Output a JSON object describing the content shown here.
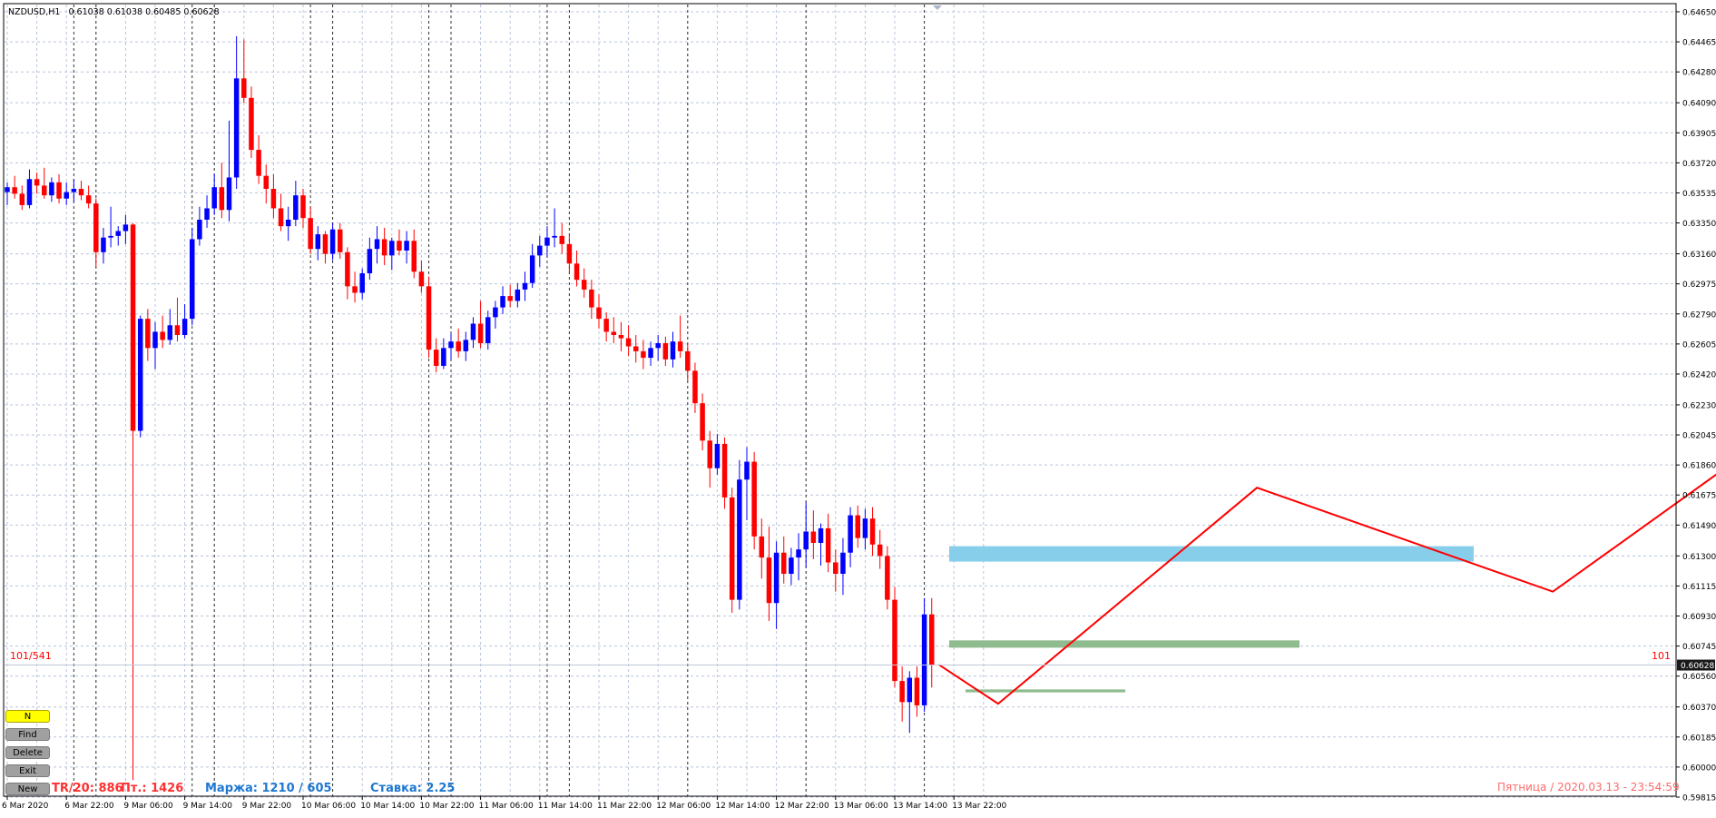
{
  "header": {
    "symbol": "NZDUSD,H1",
    "ohlc": "0.61038 0.61038 0.60485 0.60628"
  },
  "colors": {
    "bull": "#0000ff",
    "bear": "#ff0000",
    "grid": "#b8c4dc",
    "axis": "#000000",
    "zone_blue": "#87ceeb",
    "zone_green": "#8fbc8f",
    "path": "#ff0000"
  },
  "chart_data": {
    "type": "candlestick",
    "y_ticks": [
      "0.64650",
      "0.64465",
      "0.64280",
      "0.64090",
      "0.63905",
      "0.63720",
      "0.63535",
      "0.63350",
      "0.63160",
      "0.62975",
      "0.62790",
      "0.62605",
      "0.62420",
      "0.62230",
      "0.62045",
      "0.61860",
      "0.61675",
      "0.61490",
      "0.61300",
      "0.61115",
      "0.60930",
      "0.60745",
      "0.60560",
      "0.60370",
      "0.60185",
      "0.60000",
      "0.59815"
    ],
    "ylim": [
      0.59815,
      0.6465
    ],
    "current_price": "0.60628",
    "x_labels": [
      "6 Mar 2020",
      "6 Mar 22:00",
      "9 Mar 06:00",
      "9 Mar 14:00",
      "9 Mar 22:00",
      "10 Mar 06:00",
      "10 Mar 14:00",
      "10 Mar 22:00",
      "11 Mar 06:00",
      "11 Mar 14:00",
      "11 Mar 22:00",
      "12 Mar 06:00",
      "12 Mar 14:00",
      "12 Mar 22:00",
      "13 Mar 06:00",
      "13 Mar 14:00",
      "13 Mar 22:00"
    ],
    "candles": [
      [
        0.6354,
        0.636,
        0.6346,
        0.6357
      ],
      [
        0.6357,
        0.6364,
        0.635,
        0.6353
      ],
      [
        0.6353,
        0.6358,
        0.6343,
        0.6346
      ],
      [
        0.6346,
        0.6368,
        0.6344,
        0.6362
      ],
      [
        0.6362,
        0.6366,
        0.6353,
        0.6358
      ],
      [
        0.6358,
        0.6369,
        0.635,
        0.6352
      ],
      [
        0.6352,
        0.6363,
        0.6348,
        0.636
      ],
      [
        0.636,
        0.6365,
        0.6347,
        0.635
      ],
      [
        0.635,
        0.636,
        0.6346,
        0.6354
      ],
      [
        0.6354,
        0.6362,
        0.6348,
        0.6356
      ],
      [
        0.6356,
        0.6361,
        0.6349,
        0.6352
      ],
      [
        0.6352,
        0.6358,
        0.6344,
        0.6347
      ],
      [
        0.6347,
        0.635,
        0.6308,
        0.6317
      ],
      [
        0.6317,
        0.6332,
        0.631,
        0.6326
      ],
      [
        0.6326,
        0.6345,
        0.632,
        0.6327
      ],
      [
        0.6327,
        0.6333,
        0.6321,
        0.633
      ],
      [
        0.633,
        0.634,
        0.6322,
        0.6334
      ],
      [
        0.6334,
        0.6335,
        0.5992,
        0.6207
      ],
      [
        0.6207,
        0.6278,
        0.6203,
        0.6276
      ],
      [
        0.6276,
        0.6282,
        0.625,
        0.6258
      ],
      [
        0.6258,
        0.6274,
        0.6245,
        0.6268
      ],
      [
        0.6268,
        0.6278,
        0.6258,
        0.6263
      ],
      [
        0.6263,
        0.6282,
        0.626,
        0.6272
      ],
      [
        0.6272,
        0.6289,
        0.6262,
        0.6266
      ],
      [
        0.6266,
        0.6285,
        0.6264,
        0.6276
      ],
      [
        0.6276,
        0.6332,
        0.6272,
        0.6325
      ],
      [
        0.6325,
        0.6345,
        0.6321,
        0.6337
      ],
      [
        0.6337,
        0.6352,
        0.6332,
        0.6344
      ],
      [
        0.6344,
        0.6365,
        0.634,
        0.6357
      ],
      [
        0.6357,
        0.6372,
        0.6338,
        0.6343
      ],
      [
        0.6343,
        0.6398,
        0.6336,
        0.6363
      ],
      [
        0.6363,
        0.645,
        0.6356,
        0.6424
      ],
      [
        0.6424,
        0.6448,
        0.6409,
        0.6412
      ],
      [
        0.6412,
        0.6419,
        0.6375,
        0.638
      ],
      [
        0.638,
        0.6389,
        0.6359,
        0.6364
      ],
      [
        0.6364,
        0.6371,
        0.6347,
        0.6356
      ],
      [
        0.6356,
        0.6365,
        0.6338,
        0.6344
      ],
      [
        0.6344,
        0.6353,
        0.633,
        0.6333
      ],
      [
        0.6333,
        0.6345,
        0.6324,
        0.6337
      ],
      [
        0.6337,
        0.6361,
        0.6333,
        0.6352
      ],
      [
        0.6352,
        0.6356,
        0.6332,
        0.6338
      ],
      [
        0.6338,
        0.6345,
        0.6316,
        0.6319
      ],
      [
        0.6319,
        0.6333,
        0.6312,
        0.6328
      ],
      [
        0.6328,
        0.633,
        0.631,
        0.6316
      ],
      [
        0.6316,
        0.6335,
        0.6312,
        0.6331
      ],
      [
        0.6331,
        0.6335,
        0.6313,
        0.6317
      ],
      [
        0.6317,
        0.632,
        0.6288,
        0.6296
      ],
      [
        0.6296,
        0.6305,
        0.6286,
        0.6292
      ],
      [
        0.6292,
        0.6307,
        0.6288,
        0.6304
      ],
      [
        0.6304,
        0.6326,
        0.63,
        0.6319
      ],
      [
        0.6319,
        0.6333,
        0.631,
        0.6325
      ],
      [
        0.6325,
        0.6332,
        0.6309,
        0.6315
      ],
      [
        0.6315,
        0.6326,
        0.6306,
        0.6324
      ],
      [
        0.6324,
        0.6331,
        0.6315,
        0.6318
      ],
      [
        0.6318,
        0.633,
        0.631,
        0.6324
      ],
      [
        0.6324,
        0.6331,
        0.6301,
        0.6305
      ],
      [
        0.6305,
        0.6312,
        0.6292,
        0.6296
      ],
      [
        0.6296,
        0.6302,
        0.6252,
        0.6257
      ],
      [
        0.6257,
        0.6264,
        0.6243,
        0.6247
      ],
      [
        0.6247,
        0.6264,
        0.6245,
        0.6258
      ],
      [
        0.6258,
        0.6267,
        0.6251,
        0.6262
      ],
      [
        0.6262,
        0.627,
        0.6252,
        0.6256
      ],
      [
        0.6256,
        0.6268,
        0.625,
        0.6263
      ],
      [
        0.6263,
        0.6277,
        0.6258,
        0.6273
      ],
      [
        0.6273,
        0.6287,
        0.6258,
        0.6261
      ],
      [
        0.6261,
        0.6281,
        0.6257,
        0.6277
      ],
      [
        0.6277,
        0.6287,
        0.627,
        0.6283
      ],
      [
        0.6283,
        0.6296,
        0.6279,
        0.629
      ],
      [
        0.629,
        0.6297,
        0.6283,
        0.6287
      ],
      [
        0.6287,
        0.6298,
        0.6283,
        0.6294
      ],
      [
        0.6294,
        0.6305,
        0.6287,
        0.6298
      ],
      [
        0.6298,
        0.6322,
        0.6295,
        0.6315
      ],
      [
        0.6315,
        0.6327,
        0.6308,
        0.6321
      ],
      [
        0.6321,
        0.6333,
        0.6314,
        0.6326
      ],
      [
        0.6326,
        0.6344,
        0.632,
        0.6327
      ],
      [
        0.6327,
        0.6335,
        0.6316,
        0.6322
      ],
      [
        0.6322,
        0.6328,
        0.6304,
        0.631
      ],
      [
        0.631,
        0.6318,
        0.6296,
        0.63
      ],
      [
        0.63,
        0.6307,
        0.6289,
        0.6294
      ],
      [
        0.6294,
        0.63,
        0.6276,
        0.6283
      ],
      [
        0.6283,
        0.6291,
        0.627,
        0.6276
      ],
      [
        0.6276,
        0.628,
        0.6262,
        0.6268
      ],
      [
        0.6268,
        0.6277,
        0.6261,
        0.6266
      ],
      [
        0.6266,
        0.6274,
        0.6256,
        0.6264
      ],
      [
        0.6264,
        0.6272,
        0.6253,
        0.6259
      ],
      [
        0.6259,
        0.6266,
        0.6249,
        0.6256
      ],
      [
        0.6256,
        0.6263,
        0.6245,
        0.6252
      ],
      [
        0.6252,
        0.6262,
        0.6247,
        0.6258
      ],
      [
        0.6258,
        0.6266,
        0.625,
        0.6261
      ],
      [
        0.6261,
        0.6265,
        0.6247,
        0.6251
      ],
      [
        0.6251,
        0.6268,
        0.6246,
        0.6262
      ],
      [
        0.6262,
        0.6278,
        0.6252,
        0.6256
      ],
      [
        0.6256,
        0.6261,
        0.6238,
        0.6244
      ],
      [
        0.6244,
        0.6249,
        0.6218,
        0.6224
      ],
      [
        0.6224,
        0.623,
        0.6195,
        0.6201
      ],
      [
        0.6201,
        0.6207,
        0.6172,
        0.6184
      ],
      [
        0.6184,
        0.6205,
        0.618,
        0.6199
      ],
      [
        0.6199,
        0.6203,
        0.6159,
        0.6166
      ],
      [
        0.6166,
        0.6172,
        0.6095,
        0.6103
      ],
      [
        0.6103,
        0.6189,
        0.6097,
        0.6177
      ],
      [
        0.6177,
        0.6197,
        0.6152,
        0.6188
      ],
      [
        0.6188,
        0.6194,
        0.6134,
        0.6142
      ],
      [
        0.6142,
        0.6153,
        0.6116,
        0.6129
      ],
      [
        0.6129,
        0.6148,
        0.609,
        0.6101
      ],
      [
        0.6101,
        0.6139,
        0.6085,
        0.6132
      ],
      [
        0.6132,
        0.6142,
        0.6113,
        0.6119
      ],
      [
        0.6119,
        0.6135,
        0.6112,
        0.6129
      ],
      [
        0.6129,
        0.6144,
        0.6115,
        0.6134
      ],
      [
        0.6134,
        0.6163,
        0.6123,
        0.6145
      ],
      [
        0.6145,
        0.6158,
        0.6128,
        0.6138
      ],
      [
        0.6138,
        0.615,
        0.6124,
        0.6147
      ],
      [
        0.6147,
        0.6156,
        0.612,
        0.6126
      ],
      [
        0.6126,
        0.6134,
        0.6108,
        0.6119
      ],
      [
        0.6119,
        0.6141,
        0.6106,
        0.6132
      ],
      [
        0.6132,
        0.616,
        0.6123,
        0.6155
      ],
      [
        0.6155,
        0.6161,
        0.6135,
        0.6141
      ],
      [
        0.6141,
        0.6159,
        0.6134,
        0.6153
      ],
      [
        0.6153,
        0.616,
        0.613,
        0.6137
      ],
      [
        0.6137,
        0.6146,
        0.6122,
        0.613
      ],
      [
        0.613,
        0.6136,
        0.6097,
        0.6103
      ],
      [
        0.6103,
        0.6111,
        0.6049,
        0.6053
      ],
      [
        0.6053,
        0.6062,
        0.6028,
        0.604
      ],
      [
        0.604,
        0.6059,
        0.6021,
        0.6055
      ],
      [
        0.6055,
        0.6062,
        0.6031,
        0.6038
      ],
      [
        0.6038,
        0.6104,
        0.6034,
        0.6094
      ],
      [
        0.6094,
        0.6104,
        0.6049,
        0.6063
      ]
    ],
    "zones": [
      {
        "from": 0.61265,
        "to": 0.6136,
        "color": "#87ceeb"
      },
      {
        "from": 0.60735,
        "to": 0.6078,
        "color": "#8fbc8f"
      },
      {
        "from": 0.6046,
        "to": 0.60478,
        "color": "#8fbc8f"
      }
    ],
    "forecast_path": [
      [
        0,
        0.6063
      ],
      [
        8,
        0.6039
      ],
      [
        43,
        0.6172
      ],
      [
        83,
        0.6108
      ],
      [
        140,
        0.6294
      ]
    ]
  },
  "levels": {
    "left_label": "101/541",
    "right_label": "101"
  },
  "buttons": {
    "n": "N",
    "find": "Find",
    "delete": "Delete",
    "exit": "Exit",
    "new": "New"
  },
  "stats": {
    "tr": "TR/20: 886",
    "pt": "Пт.: 1426",
    "margin": "Маржа: 1210 / 605",
    "rate": "Ставка: 2.25"
  },
  "footer": {
    "datetime": "Пятница / 2020.03.13 - 23:54:59"
  }
}
